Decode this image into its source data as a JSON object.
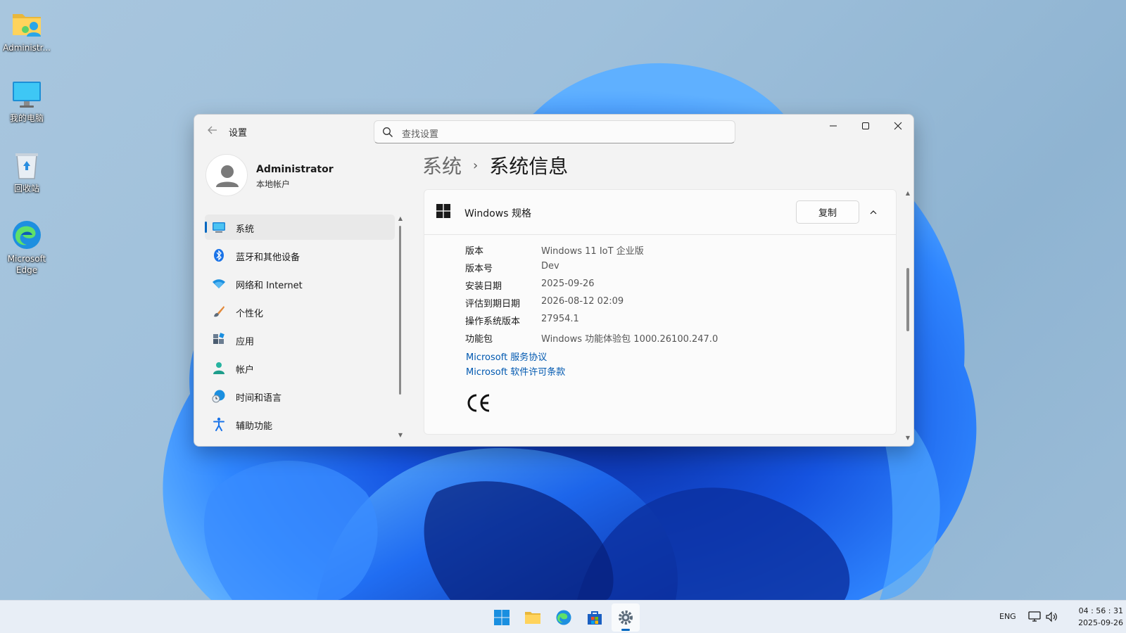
{
  "desktop": {
    "icons": [
      {
        "label": "Administr...",
        "icon": "user-folder-icon"
      },
      {
        "label": "我的电脑",
        "icon": "computer-icon"
      },
      {
        "label": "回收站",
        "icon": "recycle-bin-icon"
      },
      {
        "label": "Microsoft Edge",
        "icon": "edge-icon"
      }
    ]
  },
  "window": {
    "title": "设置",
    "search_placeholder": "查找设置",
    "controls": [
      "minimize-icon",
      "maximize-icon",
      "close-icon"
    ]
  },
  "user": {
    "name": "Administrator",
    "account_type": "本地帐户"
  },
  "nav": {
    "items": [
      {
        "label": "系统",
        "icon": "display-icon",
        "active": true
      },
      {
        "label": "蓝牙和其他设备",
        "icon": "bluetooth-icon"
      },
      {
        "label": "网络和 Internet",
        "icon": "wifi-icon"
      },
      {
        "label": "个性化",
        "icon": "brush-icon"
      },
      {
        "label": "应用",
        "icon": "apps-icon"
      },
      {
        "label": "帐户",
        "icon": "person-icon"
      },
      {
        "label": "时间和语言",
        "icon": "globe-clock-icon"
      },
      {
        "label": "辅助功能",
        "icon": "accessibility-icon"
      }
    ]
  },
  "breadcrumb": {
    "parent": "系统",
    "separator": "›",
    "current": "系统信息"
  },
  "spec_card": {
    "title": "Windows 规格",
    "copy_label": "复制",
    "rows": [
      {
        "key": "版本",
        "value": "Windows 11 IoT 企业版"
      },
      {
        "key": "版本号",
        "value": "Dev"
      },
      {
        "key": "安装日期",
        "value": "2025-09-26"
      },
      {
        "key": "评估到期日期",
        "value": "2026-08-12 02:09"
      },
      {
        "key": "操作系统版本",
        "value": "27954.1"
      },
      {
        "key": "功能包",
        "value": "Windows 功能体验包 1000.26100.247.0"
      }
    ],
    "links": [
      "Microsoft 服务协议",
      "Microsoft 软件许可条款"
    ],
    "mark": "CE"
  },
  "taskbar": {
    "apps": [
      "start-icon",
      "file-explorer-icon",
      "edge-icon",
      "store-icon",
      "settings-icon"
    ],
    "active_app": "settings-icon",
    "language": "ENG",
    "time": "04 : 56 : 31",
    "date": "2025-09-26"
  },
  "colors": {
    "accent": "#0067c0",
    "link": "#0058b0",
    "wallpaper_bg": "#a8c6de",
    "bloom": "#1a5ee8"
  }
}
